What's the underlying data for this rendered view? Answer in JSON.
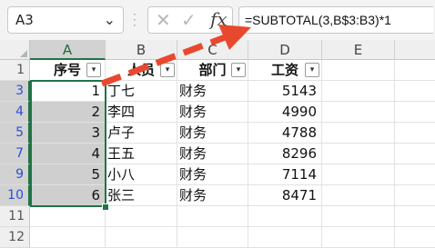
{
  "formula_bar": {
    "name_box": "A3",
    "name_box_arrow": "⌄",
    "cancel_glyph": "✕",
    "enter_glyph": "✓",
    "fx_label": "fx",
    "formula": "=SUBTOTAL(3,B$3:B3)*1"
  },
  "columns": [
    "A",
    "B",
    "C",
    "D",
    "E"
  ],
  "header_row": {
    "row": "1",
    "a": "序号",
    "b": "人员",
    "c": "部门",
    "d": "工资"
  },
  "rows": [
    {
      "row": "3",
      "a": "1",
      "b": "丁七",
      "c": "财务",
      "d": "5143"
    },
    {
      "row": "4",
      "a": "2",
      "b": "李四",
      "c": "财务",
      "d": "4990"
    },
    {
      "row": "5",
      "a": "3",
      "b": "卢子",
      "c": "财务",
      "d": "4788"
    },
    {
      "row": "7",
      "a": "4",
      "b": "王五",
      "c": "财务",
      "d": "8296"
    },
    {
      "row": "9",
      "a": "5",
      "b": "小八",
      "c": "财务",
      "d": "7114"
    },
    {
      "row": "10",
      "a": "6",
      "b": "张三",
      "c": "财务",
      "d": "8471"
    }
  ],
  "empty_rows": [
    "11",
    "12"
  ],
  "colors": {
    "accent": "#217346",
    "filtered_row": "#2a4fd6",
    "annotation_arrow": "#e8492e"
  }
}
